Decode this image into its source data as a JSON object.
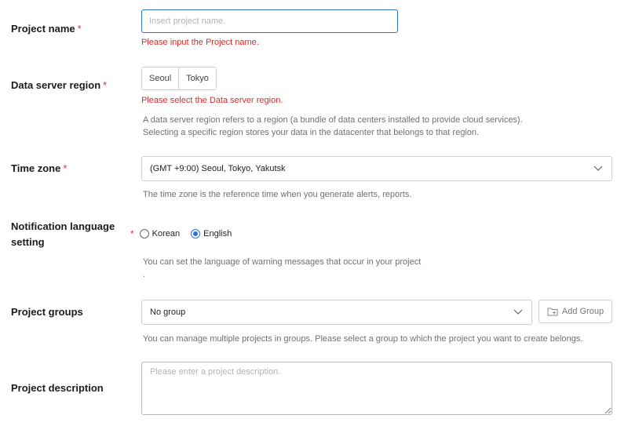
{
  "project_name": {
    "label": "Project name",
    "required_mark": "*",
    "placeholder": "Insert project name.",
    "error": "Please input the Project name."
  },
  "data_server_region": {
    "label": "Data server region",
    "required_mark": "*",
    "options": [
      "Seoul",
      "Tokyo"
    ],
    "error": "Please select the Data server region.",
    "help_line1": "A data server region refers to a region (a bundle of data centers installed to provide cloud services).",
    "help_line2": "Selecting a specific region stores your data in the datacenter that belongs to that region."
  },
  "time_zone": {
    "label": "Time zone",
    "required_mark": "*",
    "selected": "(GMT +9:00) Seoul, Tokyo, Yakutsk",
    "help": "The time zone is the reference time when you generate alerts, reports."
  },
  "notification_language": {
    "label_line1": "Notification language",
    "label_line2": "setting",
    "required_mark": "*",
    "options": [
      "Korean",
      "English"
    ],
    "selected": "English",
    "help_line1": "You can set the language of warning messages that occur in your project",
    "help_line2": "."
  },
  "project_groups": {
    "label": "Project groups",
    "selected": "No group",
    "add_group_label": "Add Group",
    "help": "You can manage multiple projects in groups. Please select a group to which the project you want to create belongs."
  },
  "project_description": {
    "label": "Project description",
    "placeholder": "Please enter a project description."
  },
  "colors": {
    "accent": "#2f6fd8",
    "error": "#dd2b2b",
    "help_text": "#707070"
  }
}
